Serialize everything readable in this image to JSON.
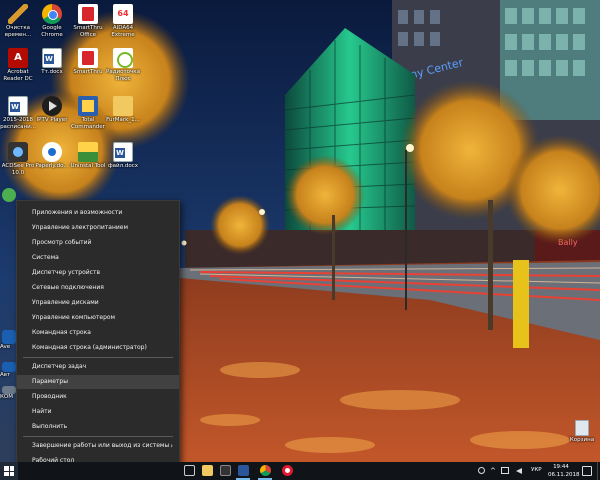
{
  "desktop": {
    "icons": [
      {
        "label": "Очистка времен...",
        "icon": "broom-icon"
      },
      {
        "label": "Google Chrome",
        "icon": "chrome-icon"
      },
      {
        "label": "SmartThru Office",
        "icon": "smartthru-icon"
      },
      {
        "label": "AIDA64 Extreme",
        "icon": "aida64-icon"
      },
      {
        "label": "Acrobat Reader DC",
        "icon": "acrobat-icon"
      },
      {
        "label": "Тт.docx",
        "icon": "word-document-icon"
      },
      {
        "label": "SmartThru",
        "icon": "smartthru-icon"
      },
      {
        "label": "Радиоточка Плюс",
        "icon": "radio-icon"
      },
      {
        "label": "2015-2018 расписани...",
        "icon": "word-document-icon"
      },
      {
        "label": "IPTV Player",
        "icon": "player-icon"
      },
      {
        "label": "Total Commander",
        "icon": "total-commander-icon"
      },
      {
        "label": "FurMark_1...",
        "icon": "folder-icon"
      },
      {
        "label": "ACDSee Pro 10.0",
        "icon": "acdsee-icon"
      },
      {
        "label": "Paperly.do...",
        "icon": "disk-icon"
      },
      {
        "label": "Uninstal Tool",
        "icon": "uninstall-tool-icon"
      },
      {
        "label": "файл.docx",
        "icon": "word-document-icon"
      }
    ],
    "partial_labels": [
      "Ave",
      "Авт",
      "КОМ"
    ],
    "recycle_bin_label": "Корзина"
  },
  "wallpaper": {
    "sign_text": "Sony Center",
    "shop_text": "Bally"
  },
  "context_menu": {
    "items": [
      {
        "label": "Приложения и возможности"
      },
      {
        "label": "Управление электропитанием"
      },
      {
        "label": "Просмотр событий"
      },
      {
        "label": "Система"
      },
      {
        "label": "Диспетчер устройств"
      },
      {
        "label": "Сетевые подключения"
      },
      {
        "label": "Управление дисками"
      },
      {
        "label": "Управление компьютером"
      },
      {
        "label": "Командная строка"
      },
      {
        "label": "Командная строка (администратор)"
      },
      {
        "label": "Диспетчер задач"
      },
      {
        "label": "Параметры"
      },
      {
        "label": "Проводник"
      },
      {
        "label": "Найти"
      },
      {
        "label": "Выполнить"
      },
      {
        "label": "Завершение работы или выход из системы"
      },
      {
        "label": "Рабочий стол"
      }
    ],
    "hovered_item": "Параметры",
    "submenu_arrow": "›"
  },
  "taskbar": {
    "pinned_apps": [
      {
        "name": "task-view",
        "icon": "task-view-icon"
      },
      {
        "name": "file-explorer",
        "icon": "folder-icon"
      },
      {
        "name": "calculator",
        "icon": "calculator-icon"
      },
      {
        "name": "word",
        "icon": "word-icon"
      },
      {
        "name": "chrome",
        "icon": "chrome-icon"
      },
      {
        "name": "opera",
        "icon": "opera-icon"
      }
    ],
    "tray": {
      "language": "УКР",
      "time": "19:44",
      "date": "06.11.2018"
    }
  },
  "colors": {
    "menu_background": "#2b2b2b",
    "menu_hover": "#414141",
    "taskbar": "#101418",
    "accent": "#76b9ed"
  }
}
